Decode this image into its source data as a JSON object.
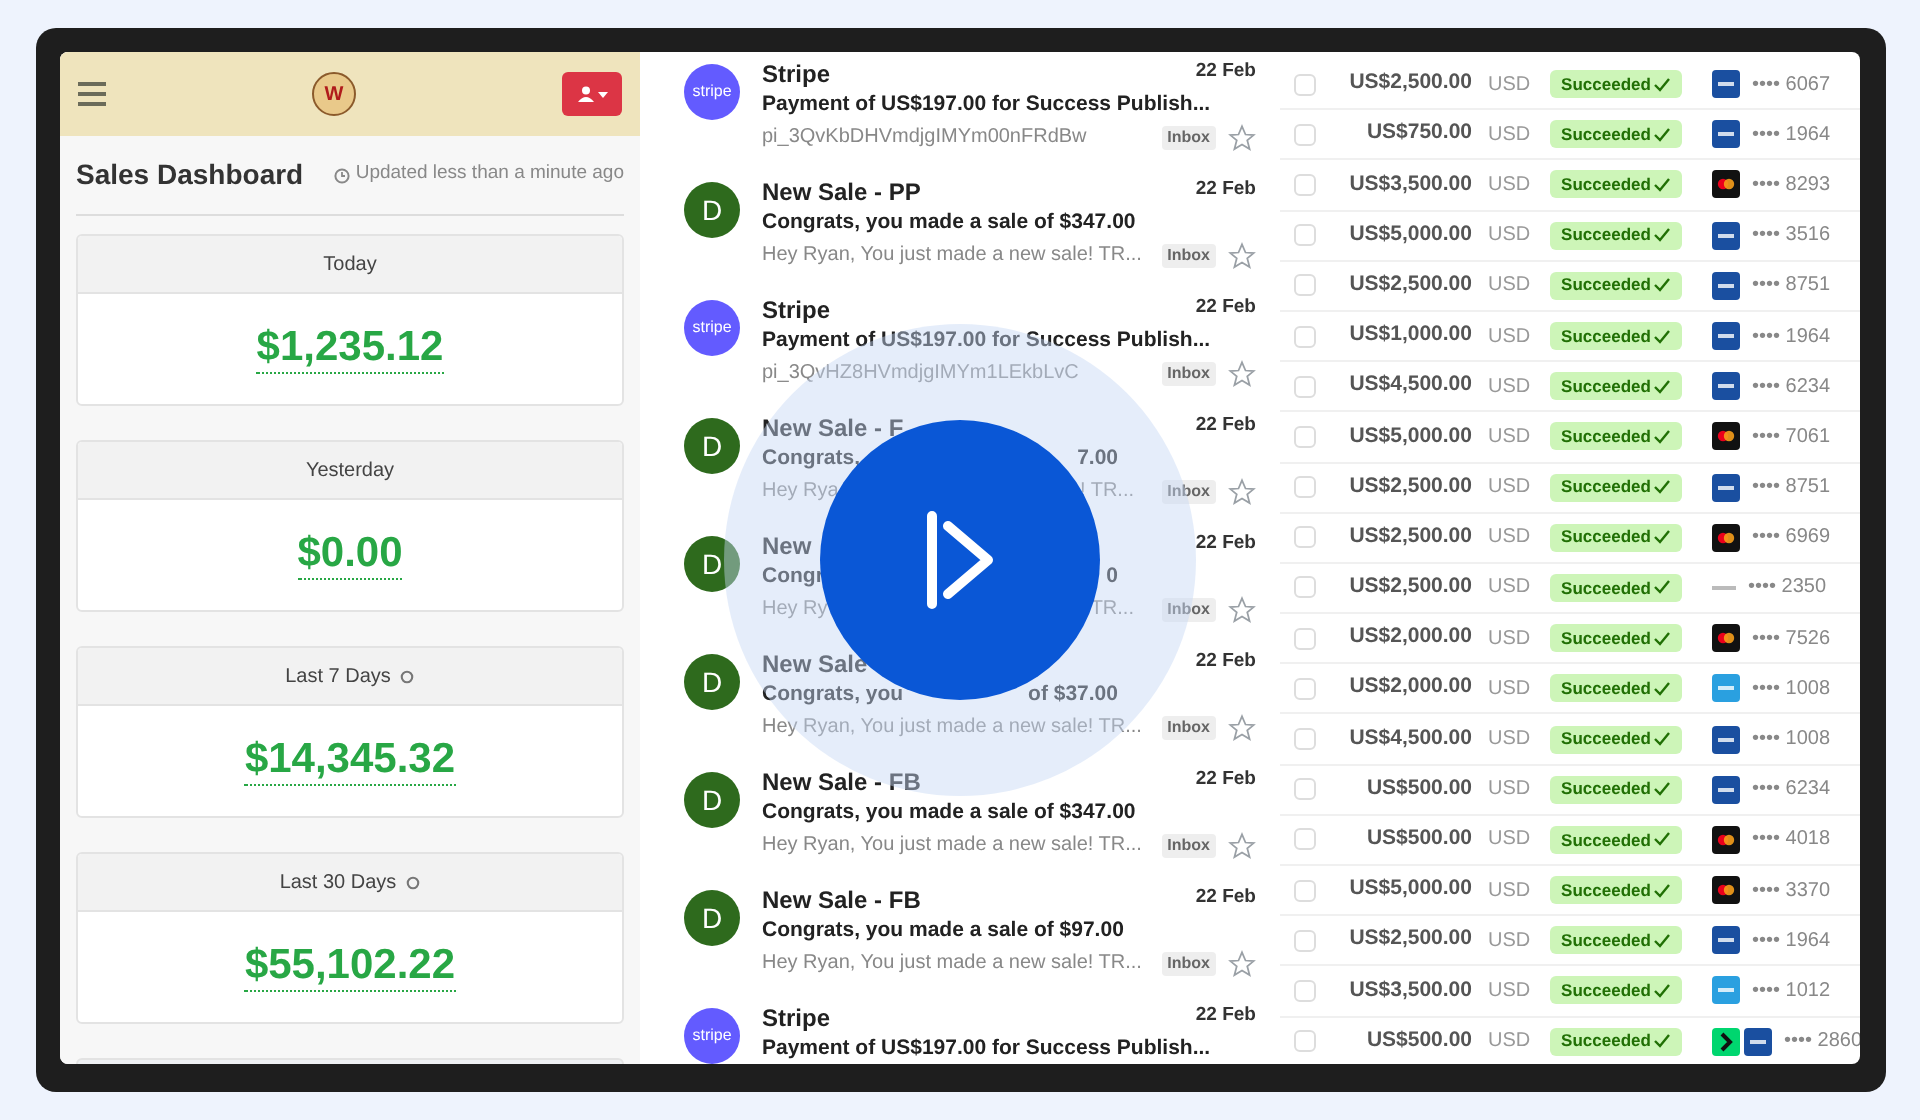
{
  "header": {
    "logo_text": "W"
  },
  "dashboard": {
    "title": "Sales Dashboard",
    "updated": "Updated less than a minute ago",
    "cards": [
      {
        "label": "Today",
        "amount": "$1,235.12",
        "info": false
      },
      {
        "label": "Yesterday",
        "amount": "$0.00",
        "info": false
      },
      {
        "label": "Last 7 Days",
        "amount": "$14,345.32",
        "info": true
      },
      {
        "label": "Last 30 Days",
        "amount": "$55,102.22",
        "info": true
      }
    ]
  },
  "emails": [
    {
      "kind": "stripe",
      "avatar": "stripe",
      "sender": "Stripe",
      "date": "22 Feb",
      "subject": "Payment of US$197.00 for Success Publish...",
      "preview": "pi_3QvKbDHVmdjgIMYm00nFRdBw",
      "label": "Inbox"
    },
    {
      "kind": "letter",
      "avatar": "D",
      "sender": "New Sale - PP",
      "date": "22 Feb",
      "subject": "Congrats, you made a sale of $347.00",
      "preview": "Hey Ryan, You just made a new sale! TR...",
      "label": "Inbox"
    },
    {
      "kind": "stripe",
      "avatar": "stripe",
      "sender": "Stripe",
      "date": "22 Feb",
      "subject": "Payment of US$197.00 for Success Publish...",
      "preview": "pi_3QvHZ8HVmdjgIMYm1LEkbLvC",
      "label": "Inbox"
    },
    {
      "kind": "letter",
      "avatar": "D",
      "sender": "New Sale - F",
      "date": "22 Feb",
      "subject": [
        "Congrats,",
        "7.00"
      ],
      "preview": [
        "Hey Rya",
        "! TR..."
      ],
      "label": "Inbox"
    },
    {
      "kind": "letter",
      "avatar": "D",
      "sender": "New",
      "date": "22 Feb",
      "subject": [
        "Congr",
        "0"
      ],
      "preview": [
        "Hey Ry",
        "TR..."
      ],
      "label": "Inbox"
    },
    {
      "kind": "letter",
      "avatar": "D",
      "sender": "New Sale",
      "date": "22 Feb",
      "subject": [
        "Congrats, you",
        "of $37.00"
      ],
      "preview": "Hey Ryan, You just made a new sale! TR...",
      "label": "Inbox"
    },
    {
      "kind": "letter",
      "avatar": "D",
      "sender": "New Sale - FB",
      "date": "22 Feb",
      "subject": "Congrats, you made a sale of $347.00",
      "preview": "Hey Ryan, You just made a new sale! TR...",
      "label": "Inbox"
    },
    {
      "kind": "letter",
      "avatar": "D",
      "sender": "New Sale - FB",
      "date": "22 Feb",
      "subject": "Congrats, you made a sale of $97.00",
      "preview": "Hey Ryan, You just made a new sale! TR...",
      "label": "Inbox"
    },
    {
      "kind": "stripe",
      "avatar": "stripe",
      "sender": "Stripe",
      "date": "22 Feb",
      "subject": "Payment of US$197.00 for Success Publish..."
    }
  ],
  "payments": [
    {
      "checked": false,
      "amount": "US$2,500.00",
      "currency": "USD",
      "status": "Succeeded",
      "cards": [
        {
          "kind": "visa"
        }
      ],
      "last4": "•••• 6067"
    },
    {
      "checked": false,
      "amount": "US$750.00",
      "currency": "USD",
      "status": "Succeeded",
      "cards": [
        {
          "kind": "visa"
        }
      ],
      "last4": "•••• 1964"
    },
    {
      "checked": false,
      "amount": "US$3,500.00",
      "currency": "USD",
      "status": "Succeeded",
      "cards": [
        {
          "kind": "mastercard"
        }
      ],
      "last4": "•••• 8293"
    },
    {
      "checked": false,
      "amount": "US$5,000.00",
      "currency": "USD",
      "status": "Succeeded",
      "cards": [
        {
          "kind": "visa"
        }
      ],
      "last4": "•••• 3516"
    },
    {
      "checked": false,
      "amount": "US$2,500.00",
      "currency": "USD",
      "status": "Succeeded",
      "cards": [
        {
          "kind": "visa"
        }
      ],
      "last4": "•••• 8751"
    },
    {
      "checked": false,
      "amount": "US$1,000.00",
      "currency": "USD",
      "status": "Succeeded",
      "cards": [
        {
          "kind": "visa"
        }
      ],
      "last4": "•••• 1964"
    },
    {
      "checked": false,
      "amount": "US$4,500.00",
      "currency": "USD",
      "status": "Succeeded",
      "cards": [
        {
          "kind": "visa"
        }
      ],
      "last4": "•••• 6234"
    },
    {
      "checked": false,
      "amount": "US$5,000.00",
      "currency": "USD",
      "status": "Succeeded",
      "cards": [
        {
          "kind": "mastercard"
        }
      ],
      "last4": "•••• 7061"
    },
    {
      "checked": false,
      "amount": "US$2,500.00",
      "currency": "USD",
      "status": "Succeeded",
      "cards": [
        {
          "kind": "visa"
        }
      ],
      "last4": "•••• 8751"
    },
    {
      "checked": false,
      "amount": "US$2,500.00",
      "currency": "USD",
      "status": "Succeeded",
      "cards": [
        {
          "kind": "mastercard"
        }
      ],
      "last4": "•••• 6969"
    },
    {
      "checked": false,
      "amount": "US$2,500.00",
      "currency": "USD",
      "status": "Succeeded",
      "cards": [
        {
          "kind": "plain"
        }
      ],
      "last4": "•••• 2350"
    },
    {
      "checked": false,
      "amount": "US$2,000.00",
      "currency": "USD",
      "status": "Succeeded",
      "cards": [
        {
          "kind": "mastercard"
        }
      ],
      "last4": "•••• 7526"
    },
    {
      "checked": false,
      "amount": "US$2,000.00",
      "currency": "USD",
      "status": "Succeeded",
      "cards": [
        {
          "kind": "amex"
        }
      ],
      "last4": "•••• 1008"
    },
    {
      "checked": false,
      "amount": "US$4,500.00",
      "currency": "USD",
      "status": "Succeeded",
      "cards": [
        {
          "kind": "visa"
        }
      ],
      "last4": "•••• 1008"
    },
    {
      "checked": false,
      "amount": "US$500.00",
      "currency": "USD",
      "status": "Succeeded",
      "cards": [
        {
          "kind": "visa"
        }
      ],
      "last4": "•••• 6234"
    },
    {
      "checked": false,
      "amount": "US$500.00",
      "currency": "USD",
      "status": "Succeeded",
      "cards": [
        {
          "kind": "mastercard"
        }
      ],
      "last4": "•••• 4018"
    },
    {
      "checked": false,
      "amount": "US$5,000.00",
      "currency": "USD",
      "status": "Succeeded",
      "cards": [
        {
          "kind": "mastercard"
        }
      ],
      "last4": "•••• 3370"
    },
    {
      "checked": false,
      "amount": "US$2,500.00",
      "currency": "USD",
      "status": "Succeeded",
      "cards": [
        {
          "kind": "visa"
        }
      ],
      "last4": "•••• 1964"
    },
    {
      "checked": false,
      "amount": "US$3,500.00",
      "currency": "USD",
      "status": "Succeeded",
      "cards": [
        {
          "kind": "amex"
        }
      ],
      "last4": "•••• 1012"
    },
    {
      "checked": false,
      "amount": "US$500.00",
      "currency": "USD",
      "status": "Succeeded",
      "cards": [
        {
          "kind": "link"
        },
        {
          "kind": "visa"
        }
      ],
      "last4": "•••• 2860"
    }
  ]
}
